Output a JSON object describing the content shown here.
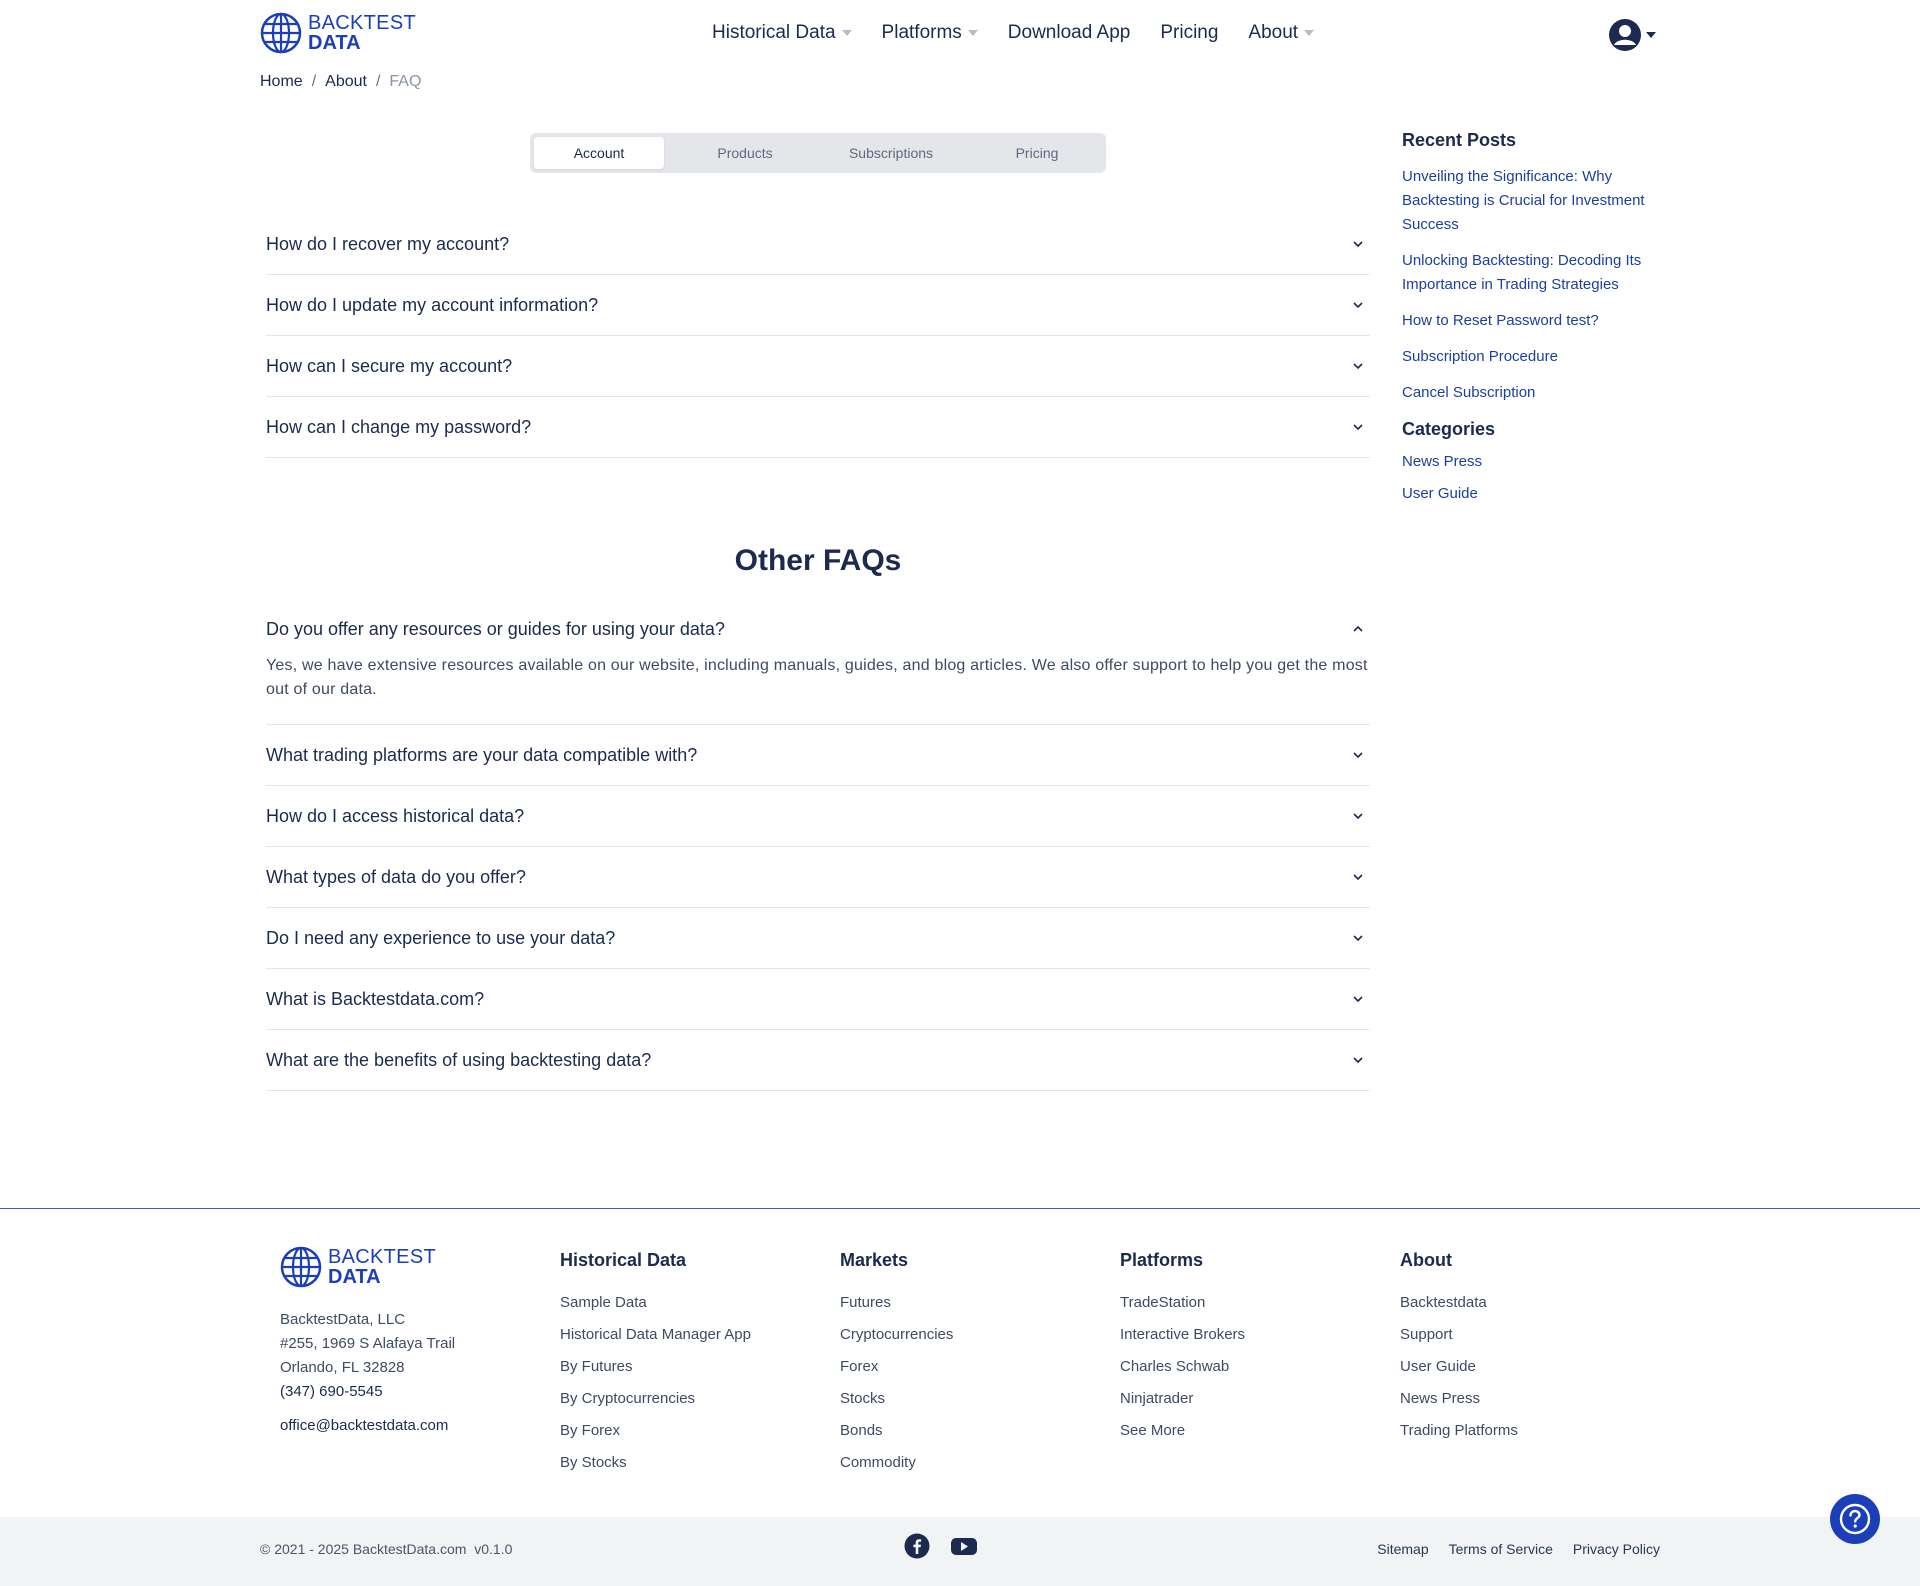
{
  "brand": {
    "line1": "BACKTEST",
    "line2": "DATA",
    "color": "#1b3fb8"
  },
  "nav": [
    {
      "label": "Historical Data",
      "dropdown": true
    },
    {
      "label": "Platforms",
      "dropdown": true
    },
    {
      "label": "Download App",
      "dropdown": false
    },
    {
      "label": "Pricing",
      "dropdown": false
    },
    {
      "label": "About",
      "dropdown": true
    }
  ],
  "user_menu": {
    "icon": "user-circle-icon"
  },
  "breadcrumb": [
    "Home",
    "About",
    "FAQ"
  ],
  "tabs": [
    {
      "label": "Account",
      "active": true
    },
    {
      "label": "Products",
      "active": false
    },
    {
      "label": "Subscriptions",
      "active": false
    },
    {
      "label": "Pricing",
      "active": false
    }
  ],
  "account_faqs": [
    "How do I recover my account?",
    "How do I update my account information?",
    "How can I secure my account?",
    "How can I change my password?"
  ],
  "other_faqs_title": "Other FAQs",
  "other_faqs": [
    {
      "q": "Do you offer any resources or guides for using your data?",
      "a": "Yes, we have extensive resources available on our website, including manuals, guides, and blog articles. We also offer support to help you get the most out of our data.",
      "expanded": true
    },
    {
      "q": "What trading platforms are your data compatible with?",
      "expanded": false
    },
    {
      "q": "How do I access historical data?",
      "expanded": false
    },
    {
      "q": "What types of data do you offer?",
      "expanded": false
    },
    {
      "q": "Do I need any experience to use your data?",
      "expanded": false
    },
    {
      "q": "What is Backtestdata.com?",
      "expanded": false
    },
    {
      "q": "What are the benefits of using backtesting data?",
      "expanded": false
    }
  ],
  "sidebar": {
    "recent_title": "Recent Posts",
    "recent": [
      "Unveiling the Significance: Why Backtesting is Crucial for Investment Success",
      "Unlocking Backtesting: Decoding Its Importance in Trading Strategies",
      "How to Reset Password test?",
      "Subscription Procedure",
      "Cancel Subscription"
    ],
    "categories_title": "Categories",
    "categories": [
      "News Press",
      "User Guide"
    ]
  },
  "footer": {
    "company": "BacktestData, LLC",
    "address1": "#255, 1969 S Alafaya Trail",
    "address2": "Orlando, FL 32828",
    "phone": "(347) 690-5545",
    "email": "office@backtestdata.com",
    "columns": [
      {
        "title": "Historical Data",
        "links": [
          "Sample Data",
          "Historical Data Manager App",
          "By Futures",
          "By Cryptocurrencies",
          "By Forex",
          "By Stocks"
        ]
      },
      {
        "title": "Markets",
        "links": [
          "Futures",
          "Cryptocurrencies",
          "Forex",
          "Stocks",
          "Bonds",
          "Commodity"
        ]
      },
      {
        "title": "Platforms",
        "links": [
          "TradeStation",
          "Interactive Brokers",
          "Charles Schwab",
          "Ninjatrader",
          "See More"
        ]
      },
      {
        "title": "About",
        "links": [
          "Backtestdata",
          "Support",
          "User Guide",
          "News Press",
          "Trading Platforms"
        ]
      }
    ],
    "copyright": "© 2021 - 2025 BacktestData.com",
    "version": "v0.1.0",
    "social": [
      "facebook-icon",
      "youtube-icon"
    ],
    "legal": [
      "Sitemap",
      "Terms of Service",
      "Privacy Policy"
    ]
  },
  "colors": {
    "text": "#1c2a4f",
    "accent": "#1b3fb8",
    "link": "#1b3f9e",
    "bottom_bar": "#f2f3f5"
  }
}
